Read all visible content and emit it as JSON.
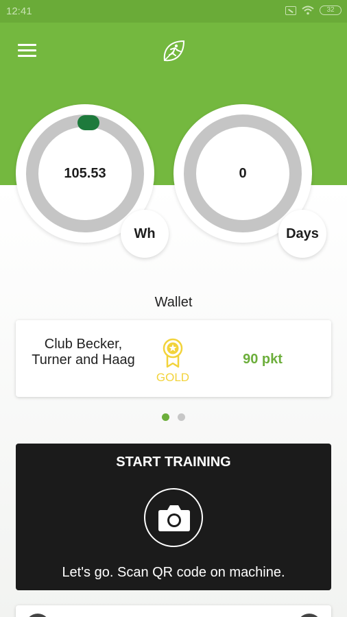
{
  "status_bar": {
    "time": "12:41",
    "battery": "32"
  },
  "header": {
    "menu_icon": "menu-icon",
    "logo_icon": "leaf-runner-logo-icon"
  },
  "gauges": [
    {
      "value": "105.53",
      "unit": "Wh",
      "progress_indicator": "knob at top"
    },
    {
      "value": "0",
      "unit": "Days"
    }
  ],
  "wallet": {
    "title": "Wallet",
    "club_name": "Club Becker, Turner and Haag",
    "tier": "GOLD",
    "points": "90 pkt",
    "page_count": 2,
    "active_page": 1
  },
  "training": {
    "title": "START TRAINING",
    "subtitle": "Let's go. Scan QR code on machine.",
    "icon": "camera-icon"
  },
  "colors": {
    "brand_green": "#74b83f",
    "points_green": "#6cae3b",
    "knob_green": "#1e7a3c",
    "gold": "#f2d33b",
    "gauge_ring": "#c5c5c5",
    "dark_card": "#1b1b1b"
  }
}
